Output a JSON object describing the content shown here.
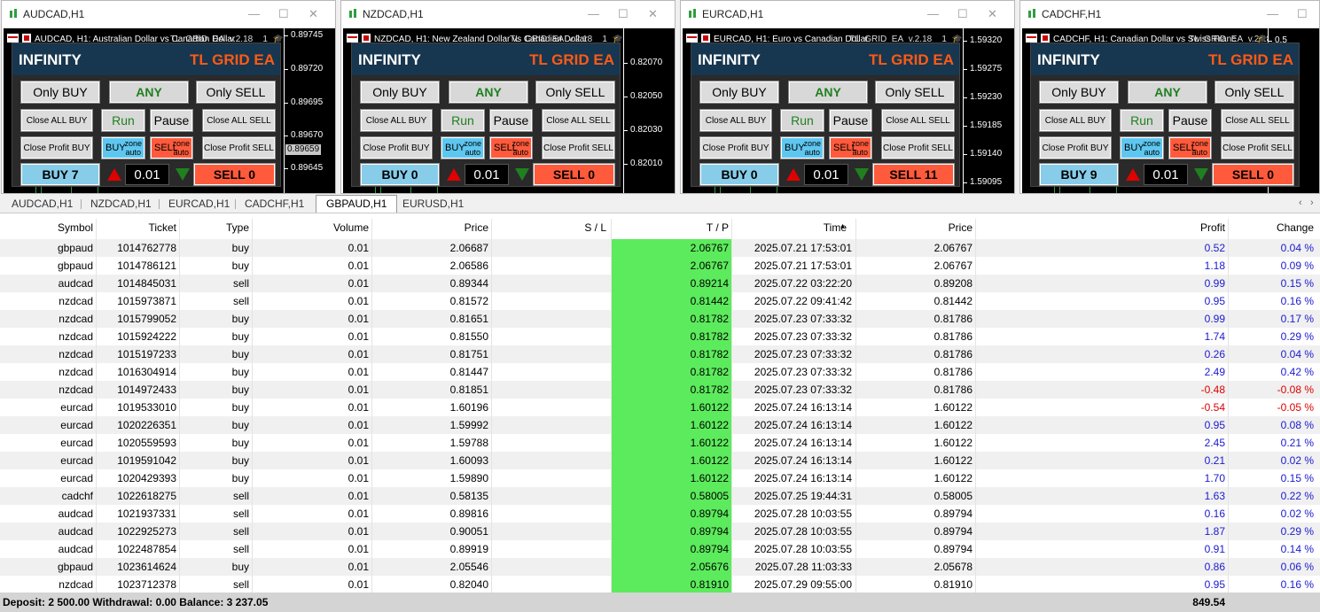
{
  "chart_windows": [
    {
      "title": "AUDCAD,H1",
      "header": "AUDCAD, H1:  Australian Dollar vs Canadian Dollar",
      "ea_name": "TL_GRID_EA_v.2.18__1",
      "prices": [
        "0.89745",
        "0.89720",
        "0.89695",
        "0.89670",
        "0.89645"
      ],
      "current": "0.89659",
      "buy_label": "BUY 7",
      "sell_label": "SELL 0"
    },
    {
      "title": "NZDCAD,H1",
      "header": "NZDCAD, H1:  New Zealand Dollar vs Canadian Dollar",
      "ea_name": "TL_GRID_EA_v.2.18__1",
      "prices": [
        "0.82070",
        "0.82050",
        "0.82030",
        "0.82010"
      ],
      "current": "",
      "buy_label": "BUY 0",
      "sell_label": "SELL 0"
    },
    {
      "title": "EURCAD,H1",
      "header": "EURCAD, H1:  Euro vs Canadian Dollar",
      "ea_name": "TL_GRID_EA_v.2.18__1",
      "prices": [
        "1.59320",
        "1.59275",
        "1.59230",
        "1.59185",
        "1.59140",
        "1.59095"
      ],
      "current": "",
      "buy_label": "BUY 0",
      "sell_label": "SELL 11"
    },
    {
      "title": "CADCHF,H1",
      "header": "CADCHF, H1:  Canadian Dollar vs Swiss Franc",
      "ea_name": "TL_GRID_EA_v.2.18__1",
      "prices": [
        "0.5",
        "0.5",
        "0.5",
        "0.5",
        "0.5",
        "0.5"
      ],
      "current": "",
      "buy_label": "BUY 9",
      "sell_label": "SELL 0"
    }
  ],
  "panel": {
    "brand": "INFINITY",
    "ea_title": "TL GRID EA",
    "only_buy": "Only BUY",
    "any": "ANY",
    "only_sell": "Only SELL",
    "close_all_buy": "Close ALL BUY",
    "run": "Run",
    "pause": "Pause",
    "close_all_sell": "Close ALL SELL",
    "close_profit_buy": "Close Profit BUY",
    "buy_zone": "BUY",
    "sell_zone": "SELL",
    "zone": "zone",
    "auto": "auto",
    "close_profit_sell": "Close Profit SELL",
    "lot": "0.01"
  },
  "tabs": [
    "AUDCAD,H1",
    "NZDCAD,H1",
    "EURCAD,H1",
    "CADCHF,H1",
    "GBPAUD,H1",
    "EURUSD,H1"
  ],
  "active_tab": 4,
  "columns": [
    "Symbol",
    "Ticket",
    "Type",
    "Volume",
    "Price",
    "S / L",
    "T / P",
    "Time",
    "Price",
    "Profit",
    "Change"
  ],
  "rows": [
    [
      "gbpaud",
      "1014762778",
      "buy",
      "0.01",
      "2.06687",
      "",
      "2.06767",
      "2025.07.21 17:53:01",
      "2.06767",
      "0.52",
      "0.04 %"
    ],
    [
      "gbpaud",
      "1014786121",
      "buy",
      "0.01",
      "2.06586",
      "",
      "2.06767",
      "2025.07.21 17:53:01",
      "2.06767",
      "1.18",
      "0.09 %"
    ],
    [
      "audcad",
      "1014845031",
      "sell",
      "0.01",
      "0.89344",
      "",
      "0.89214",
      "2025.07.22 03:22:20",
      "0.89208",
      "0.99",
      "0.15 %"
    ],
    [
      "nzdcad",
      "1015973871",
      "sell",
      "0.01",
      "0.81572",
      "",
      "0.81442",
      "2025.07.22 09:41:42",
      "0.81442",
      "0.95",
      "0.16 %"
    ],
    [
      "nzdcad",
      "1015799052",
      "buy",
      "0.01",
      "0.81651",
      "",
      "0.81782",
      "2025.07.23 07:33:32",
      "0.81786",
      "0.99",
      "0.17 %"
    ],
    [
      "nzdcad",
      "1015924222",
      "buy",
      "0.01",
      "0.81550",
      "",
      "0.81782",
      "2025.07.23 07:33:32",
      "0.81786",
      "1.74",
      "0.29 %"
    ],
    [
      "nzdcad",
      "1015197233",
      "buy",
      "0.01",
      "0.81751",
      "",
      "0.81782",
      "2025.07.23 07:33:32",
      "0.81786",
      "0.26",
      "0.04 %"
    ],
    [
      "nzdcad",
      "1016304914",
      "buy",
      "0.01",
      "0.81447",
      "",
      "0.81782",
      "2025.07.23 07:33:32",
      "0.81786",
      "2.49",
      "0.42 %"
    ],
    [
      "nzdcad",
      "1014972433",
      "buy",
      "0.01",
      "0.81851",
      "",
      "0.81782",
      "2025.07.23 07:33:32",
      "0.81786",
      "-0.48",
      "-0.08 %"
    ],
    [
      "eurcad",
      "1019533010",
      "buy",
      "0.01",
      "1.60196",
      "",
      "1.60122",
      "2025.07.24 16:13:14",
      "1.60122",
      "-0.54",
      "-0.05 %"
    ],
    [
      "eurcad",
      "1020226351",
      "buy",
      "0.01",
      "1.59992",
      "",
      "1.60122",
      "2025.07.24 16:13:14",
      "1.60122",
      "0.95",
      "0.08 %"
    ],
    [
      "eurcad",
      "1020559593",
      "buy",
      "0.01",
      "1.59788",
      "",
      "1.60122",
      "2025.07.24 16:13:14",
      "1.60122",
      "2.45",
      "0.21 %"
    ],
    [
      "eurcad",
      "1019591042",
      "buy",
      "0.01",
      "1.60093",
      "",
      "1.60122",
      "2025.07.24 16:13:14",
      "1.60122",
      "0.21",
      "0.02 %"
    ],
    [
      "eurcad",
      "1020429393",
      "buy",
      "0.01",
      "1.59890",
      "",
      "1.60122",
      "2025.07.24 16:13:14",
      "1.60122",
      "1.70",
      "0.15 %"
    ],
    [
      "cadchf",
      "1022618275",
      "sell",
      "0.01",
      "0.58135",
      "",
      "0.58005",
      "2025.07.25 19:44:31",
      "0.58005",
      "1.63",
      "0.22 %"
    ],
    [
      "audcad",
      "1021937331",
      "sell",
      "0.01",
      "0.89816",
      "",
      "0.89794",
      "2025.07.28 10:03:55",
      "0.89794",
      "0.16",
      "0.02 %"
    ],
    [
      "audcad",
      "1022925273",
      "sell",
      "0.01",
      "0.90051",
      "",
      "0.89794",
      "2025.07.28 10:03:55",
      "0.89794",
      "1.87",
      "0.29 %"
    ],
    [
      "audcad",
      "1022487854",
      "sell",
      "0.01",
      "0.89919",
      "",
      "0.89794",
      "2025.07.28 10:03:55",
      "0.89794",
      "0.91",
      "0.14 %"
    ],
    [
      "gbpaud",
      "1023614624",
      "buy",
      "0.01",
      "2.05546",
      "",
      "2.05676",
      "2025.07.28 11:03:33",
      "2.05678",
      "0.86",
      "0.06 %"
    ],
    [
      "nzdcad",
      "1023712378",
      "sell",
      "0.01",
      "0.82040",
      "",
      "0.81910",
      "2025.07.29 09:55:00",
      "0.81910",
      "0.95",
      "0.16 %"
    ]
  ],
  "footer": {
    "summary": "Deposit: 2 500.00  Withdrawal: 0.00  Balance: 3 237.05",
    "total_profit": "849.54"
  },
  "colors": {
    "tp_bg": "#5ceb5c",
    "profit_pos": "#1a1ad0",
    "profit_neg": "#e00000",
    "panel_head": "#17364f",
    "ea_orange": "#ff5a14",
    "sell_red": "#ff5a3c",
    "buy_blue": "#87cdea"
  }
}
